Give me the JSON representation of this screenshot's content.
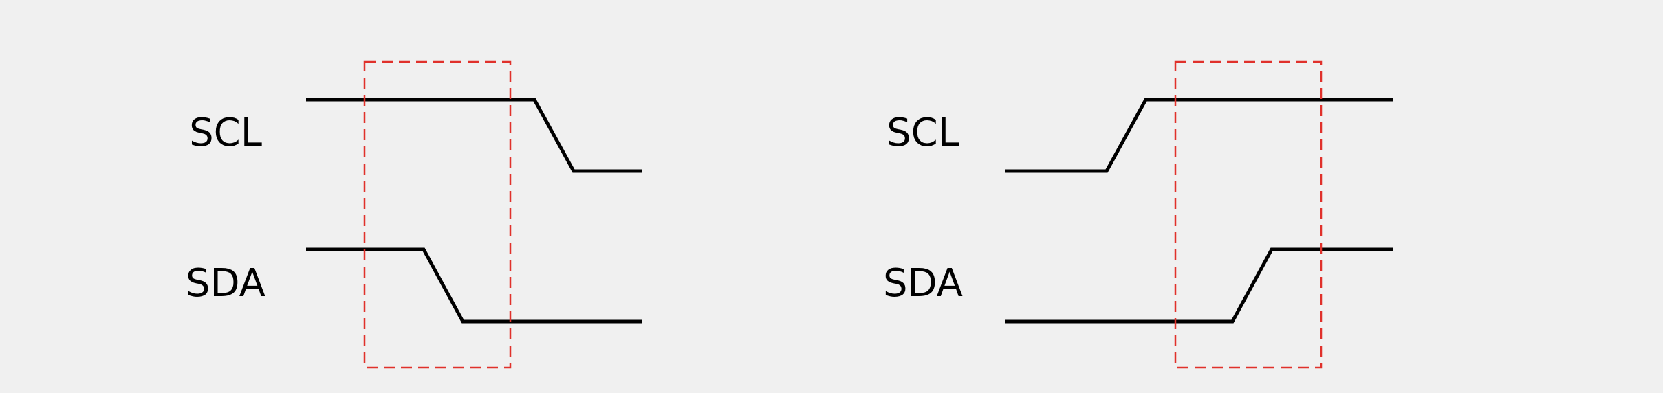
{
  "diagrams": [
    {
      "id": "start-condition",
      "signals": [
        {
          "label": "SCL",
          "levels": [
            "high",
            "high",
            "high",
            "high",
            "high",
            "low"
          ]
        },
        {
          "label": "SDA",
          "levels": [
            "high",
            "high",
            "low",
            "low",
            "low",
            "low"
          ]
        }
      ]
    },
    {
      "id": "stop-condition",
      "signals": [
        {
          "label": "SCL",
          "levels": [
            "low",
            "high",
            "high",
            "high",
            "high",
            "high"
          ]
        },
        {
          "label": "SDA",
          "levels": [
            "low",
            "low",
            "low",
            "low",
            "high",
            "high"
          ]
        }
      ]
    }
  ],
  "colors": {
    "background": "#f0f0f0",
    "signal": "#000000",
    "highlight_box": "#e0312b"
  }
}
